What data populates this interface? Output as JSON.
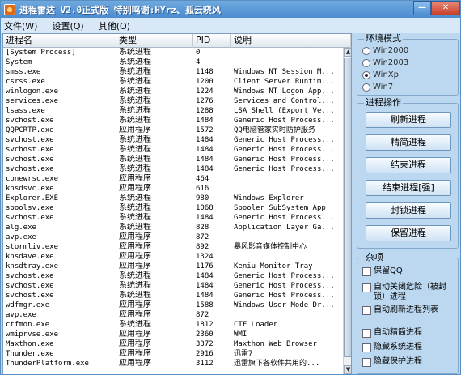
{
  "window": {
    "title": "进程雷达 V2.0正式版 特别鸣谢:HYrz、孤云晓风"
  },
  "menu": [
    {
      "label": "文件(W)"
    },
    {
      "label": "设置(Q)"
    },
    {
      "label": "其他(O)"
    }
  ],
  "table": {
    "columns": [
      "进程名",
      "类型",
      "PID",
      "说明"
    ],
    "rows": [
      [
        "[System Process]",
        "系统进程",
        "0",
        ""
      ],
      [
        "System",
        "系统进程",
        "4",
        ""
      ],
      [
        "smss.exe",
        "系统进程",
        "1148",
        "Windows NT Session M..."
      ],
      [
        "csrss.exe",
        "系统进程",
        "1200",
        "Client Server Runtim..."
      ],
      [
        "winlogon.exe",
        "系统进程",
        "1224",
        "Windows NT Logon App..."
      ],
      [
        "services.exe",
        "系统进程",
        "1276",
        "Services and Control..."
      ],
      [
        "lsass.exe",
        "系统进程",
        "1288",
        "LSA Shell (Export Ve..."
      ],
      [
        "svchost.exe",
        "系统进程",
        "1484",
        "Generic Host Process..."
      ],
      [
        "QQPCRTP.exe",
        "应用程序",
        "1572",
        "QQ电脑管家实时防护服务"
      ],
      [
        "svchost.exe",
        "系统进程",
        "1484",
        "Generic Host Process..."
      ],
      [
        "svchost.exe",
        "系统进程",
        "1484",
        "Generic Host Process..."
      ],
      [
        "svchost.exe",
        "系统进程",
        "1484",
        "Generic Host Process..."
      ],
      [
        "svchost.exe",
        "系统进程",
        "1484",
        "Generic Host Process..."
      ],
      [
        "conewrsc.exe",
        "应用程序",
        "464",
        ""
      ],
      [
        "knsdsvc.exe",
        "应用程序",
        "616",
        ""
      ],
      [
        "Explorer.EXE",
        "系统进程",
        "980",
        "Windows Explorer"
      ],
      [
        "spoolsv.exe",
        "系统进程",
        "1068",
        "Spooler SubSystem App"
      ],
      [
        "svchost.exe",
        "系统进程",
        "1484",
        "Generic Host Process..."
      ],
      [
        "alg.exe",
        "系统进程",
        "828",
        "Application Layer Ga..."
      ],
      [
        "avp.exe",
        "应用程序",
        "872",
        ""
      ],
      [
        "stormliv.exe",
        "应用程序",
        "892",
        "暴风影音媒体控制中心"
      ],
      [
        "knsdave.exe",
        "应用程序",
        "1324",
        ""
      ],
      [
        "knsdtray.exe",
        "应用程序",
        "1176",
        "Keniu Monitor Tray"
      ],
      [
        "svchost.exe",
        "系统进程",
        "1484",
        "Generic Host Process..."
      ],
      [
        "svchost.exe",
        "系统进程",
        "1484",
        "Generic Host Process..."
      ],
      [
        "svchost.exe",
        "系统进程",
        "1484",
        "Generic Host Process..."
      ],
      [
        "wdfmgr.exe",
        "应用程序",
        "1588",
        "Windows User Mode Dr..."
      ],
      [
        "avp.exe",
        "应用程序",
        "872",
        ""
      ],
      [
        "ctfmon.exe",
        "系统进程",
        "1812",
        "CTF Loader"
      ],
      [
        "wmiprvse.exe",
        "应用程序",
        "2360",
        "WMI"
      ],
      [
        "Maxthon.exe",
        "应用程序",
        "3372",
        "Maxthon Web Browser"
      ],
      [
        "Thunder.exe",
        "应用程序",
        "2916",
        "迅雷7"
      ],
      [
        "ThunderPlatform.exe",
        "应用程序",
        "3112",
        "迅雷旗下各软件共用的..."
      ]
    ]
  },
  "env": {
    "title": "环境模式",
    "options": [
      {
        "label": "Win2000",
        "selected": false
      },
      {
        "label": "Win2003",
        "selected": false
      },
      {
        "label": "WinXp",
        "selected": true
      },
      {
        "label": "Win7",
        "selected": false
      }
    ]
  },
  "ops": {
    "title": "进程操作",
    "buttons": [
      "刷新进程",
      "精简进程",
      "结束进程",
      "结束进程[强]",
      "封锁进程",
      "保留进程"
    ]
  },
  "misc": {
    "title": "杂项",
    "checkboxes": [
      "保留QQ",
      "自动关闭危险（被封锁）进程",
      "自动刷新进程列表",
      "自动精简进程",
      "隐藏系统进程",
      "隐藏保护进程"
    ]
  }
}
